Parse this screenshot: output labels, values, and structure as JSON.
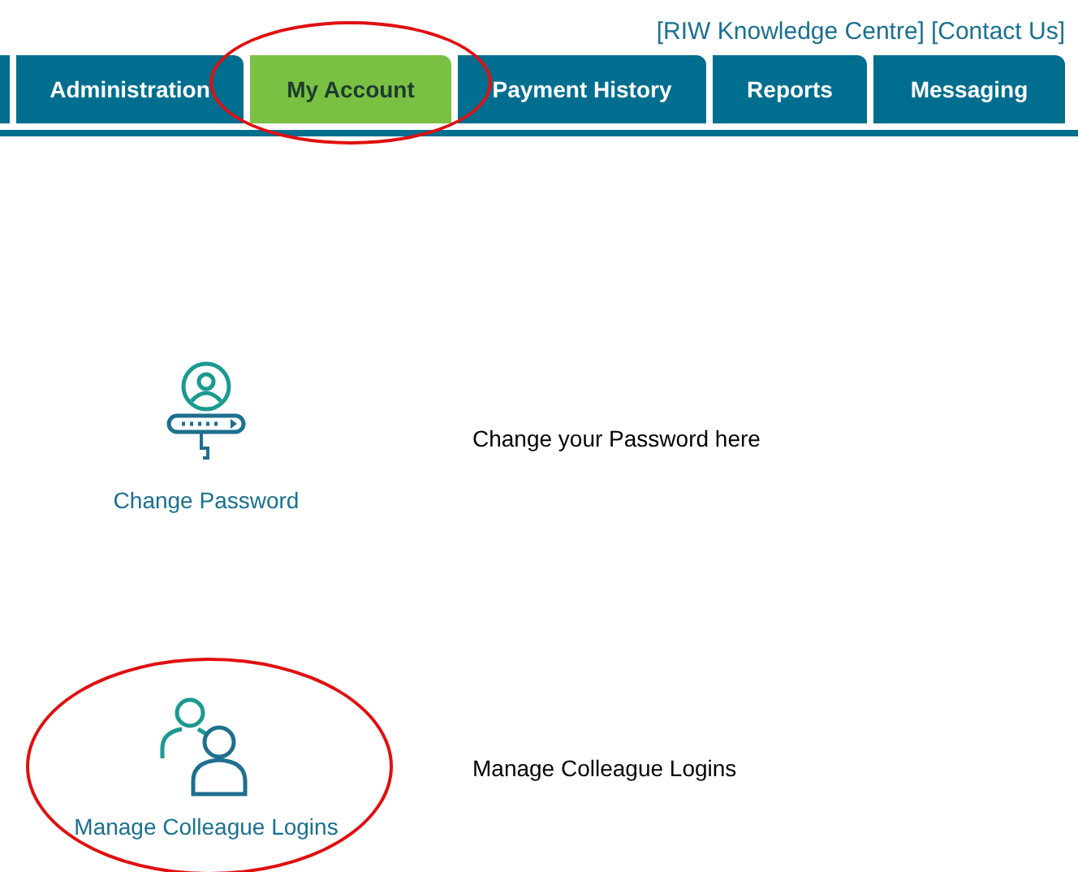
{
  "header_links": [
    "[RIW Knowledge Centre]",
    "[Contact Us]"
  ],
  "tabs": [
    {
      "label": "Administration",
      "selected": false,
      "circled": false
    },
    {
      "label": "My Account",
      "selected": true,
      "circled": true
    },
    {
      "label": "Payment History",
      "selected": false,
      "circled": false
    },
    {
      "label": "Reports",
      "selected": false,
      "circled": false
    },
    {
      "label": "Messaging",
      "selected": false,
      "circled": false
    }
  ],
  "options": [
    {
      "kind": "password",
      "label": "Change Password",
      "description": "Change your Password here",
      "circled": false
    },
    {
      "kind": "colleagues",
      "label": "Manage Colleague Logins",
      "description": "Manage Colleague Logins",
      "circled": true
    }
  ]
}
